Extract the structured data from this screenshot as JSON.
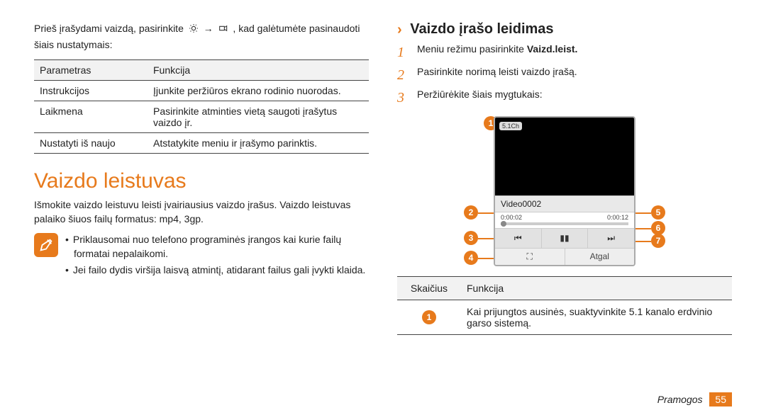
{
  "left": {
    "intro": "Prieš įrašydami vaizdą, pasirinkite ",
    "intro_tail": ", kad galėtumėte pasinaudoti šiais nustatymais:",
    "arrow": "→",
    "table": {
      "h1": "Parametras",
      "h2": "Funkcija",
      "rows": [
        {
          "p": "Instrukcijos",
          "f": "Įjunkite peržiūros ekrano rodinio nuorodas."
        },
        {
          "p": "Laikmena",
          "f": "Pasirinkite atminties vietą saugoti įrašytus vaizdo įr."
        },
        {
          "p": "Nustatyti iš naujo",
          "f": "Atstatykite meniu ir įrašymo parinktis."
        }
      ]
    },
    "title": "Vaizdo leistuvas",
    "desc": "Išmokite vaizdo leistuvu leisti įvairiausius vaizdo įrašus. Vaizdo leistuvas palaiko šiuos failų formatus: mp4, 3gp.",
    "notes": [
      "Priklausomai nuo telefono programinės įrangos kai kurie failų formatai nepalaikomi.",
      "Jei failo dydis viršija laisvą atmintį, atidarant failus gali įvykti klaida."
    ]
  },
  "right": {
    "section": "Vaizdo įrašo leidimas",
    "steps": [
      {
        "n": "1",
        "pre": "Meniu režimu pasirinkite ",
        "bold": "Vaizd.leist."
      },
      {
        "n": "2",
        "pre": "Pasirinkite norimą leisti vaizdo įrašą.",
        "bold": ""
      },
      {
        "n": "3",
        "pre": "Peržiūrėkite šiais mygtukais:",
        "bold": ""
      }
    ],
    "player": {
      "badge": "5.1Ch",
      "title": "Video0002",
      "time_left": "0:00:02",
      "time_right": "0:00:12",
      "back": "Atgal",
      "fullscreen": "⛶"
    },
    "callouts": {
      "c1": "1",
      "c2": "2",
      "c3": "3",
      "c4": "4",
      "c5": "5",
      "c6": "6",
      "c7": "7"
    },
    "func_table": {
      "h1": "Skaičius",
      "h2": "Funkcija",
      "row1_num": "1",
      "row1": "Kai prijungtos ausinės, suaktyvinkite 5.1 kanalo erdvinio garso sistemą."
    }
  },
  "footer": {
    "category": "Pramogos",
    "page": "55"
  }
}
